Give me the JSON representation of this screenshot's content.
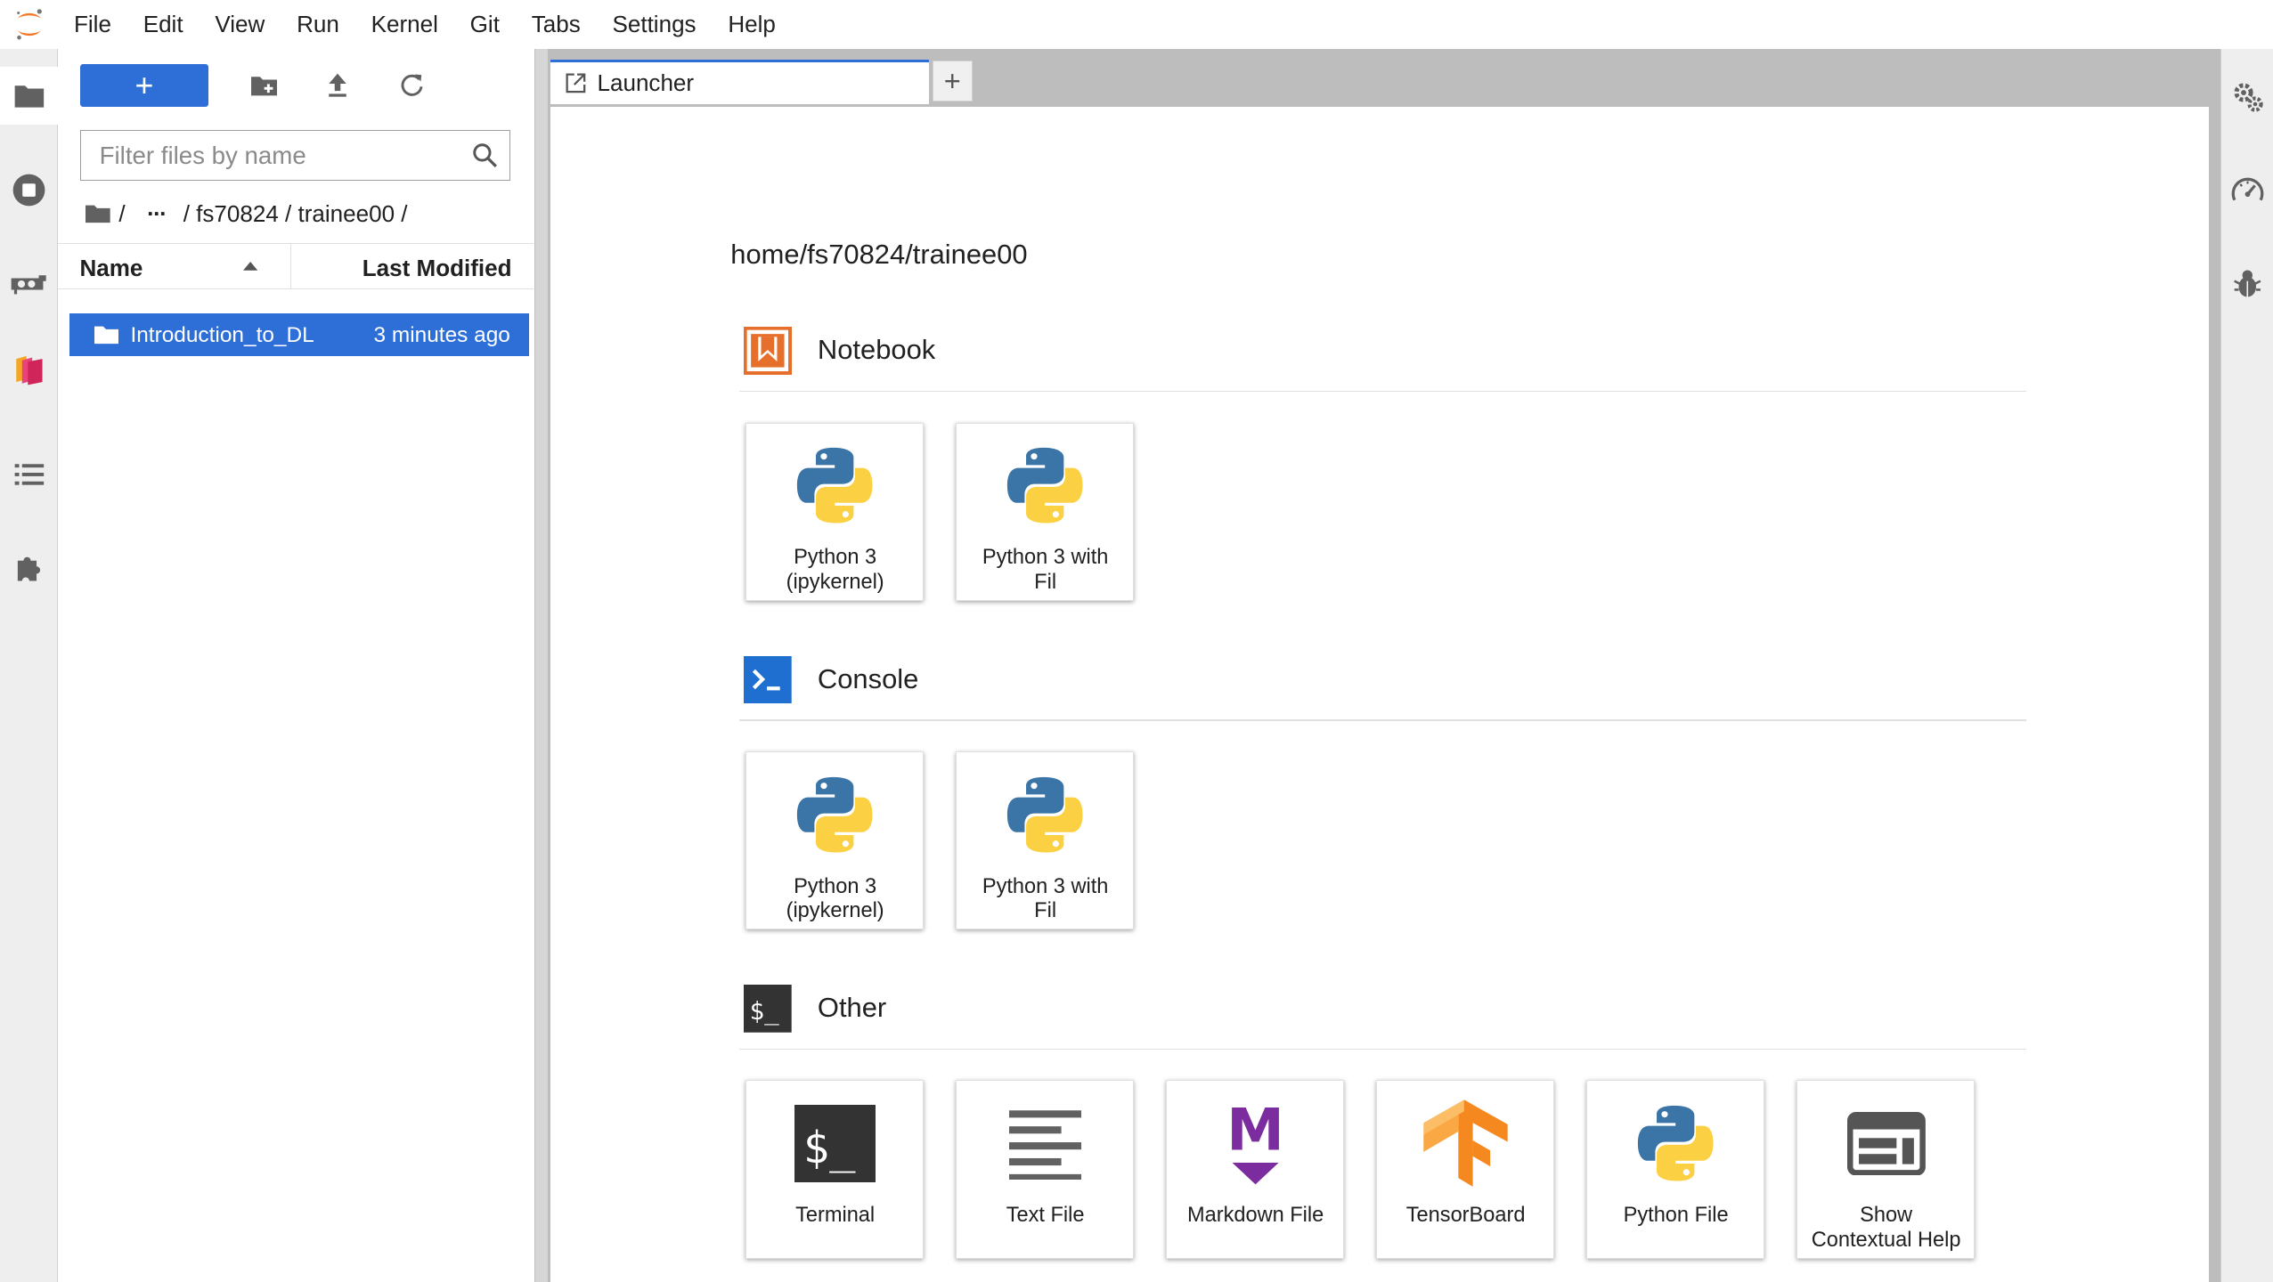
{
  "menu": [
    "File",
    "Edit",
    "View",
    "Run",
    "Kernel",
    "Git",
    "Tabs",
    "Settings",
    "Help"
  ],
  "filebrowser": {
    "new_label": "+",
    "filter_placeholder": "Filter files by name",
    "breadcrumb": {
      "root": "/",
      "ellipsis": "···",
      "path": "/ fs70824 / trainee00 /"
    },
    "columns": {
      "name": "Name",
      "modified": "Last Modified"
    },
    "items": [
      {
        "name": "Introduction_to_DL",
        "modified": "3 minutes ago",
        "type": "folder",
        "selected": true
      }
    ]
  },
  "tabs": [
    {
      "label": "Launcher",
      "active": true
    }
  ],
  "add_tab_label": "+",
  "launcher": {
    "cwd": "home/fs70824/trainee00",
    "sections": [
      {
        "title": "Notebook",
        "icon": "notebook-icon",
        "cards": [
          {
            "label_line1": "Python 3",
            "label_line2": "(ipykernel)",
            "icon": "python-icon"
          },
          {
            "label_line1": "Python 3 with",
            "label_line2": "Fil",
            "icon": "python-icon"
          }
        ]
      },
      {
        "title": "Console",
        "icon": "console-icon",
        "cards": [
          {
            "label_line1": "Python 3",
            "label_line2": "(ipykernel)",
            "icon": "python-icon"
          },
          {
            "label_line1": "Python 3 with",
            "label_line2": "Fil",
            "icon": "python-icon"
          }
        ]
      },
      {
        "title": "Other",
        "icon": "terminal-icon",
        "cards": [
          {
            "label_line1": "Terminal",
            "label_line2": "",
            "icon": "terminal-icon"
          },
          {
            "label_line1": "Text File",
            "label_line2": "",
            "icon": "text-file-icon"
          },
          {
            "label_line1": "Markdown File",
            "label_line2": "",
            "icon": "markdown-icon"
          },
          {
            "label_line1": "TensorBoard",
            "label_line2": "",
            "icon": "tensorboard-icon"
          },
          {
            "label_line1": "Python File",
            "label_line2": "",
            "icon": "python-icon"
          },
          {
            "label_line1": "Show",
            "label_line2": "Contextual Help",
            "icon": "contextual-help-icon"
          }
        ]
      }
    ]
  },
  "colors": {
    "accent": "#2d6fd6",
    "notebook_orange": "#e66f2b",
    "console_blue": "#1f6fd0",
    "terminal_dark": "#333333",
    "markdown_purple": "#7b2c9e",
    "tensorboard_orange": "#f5891f"
  }
}
